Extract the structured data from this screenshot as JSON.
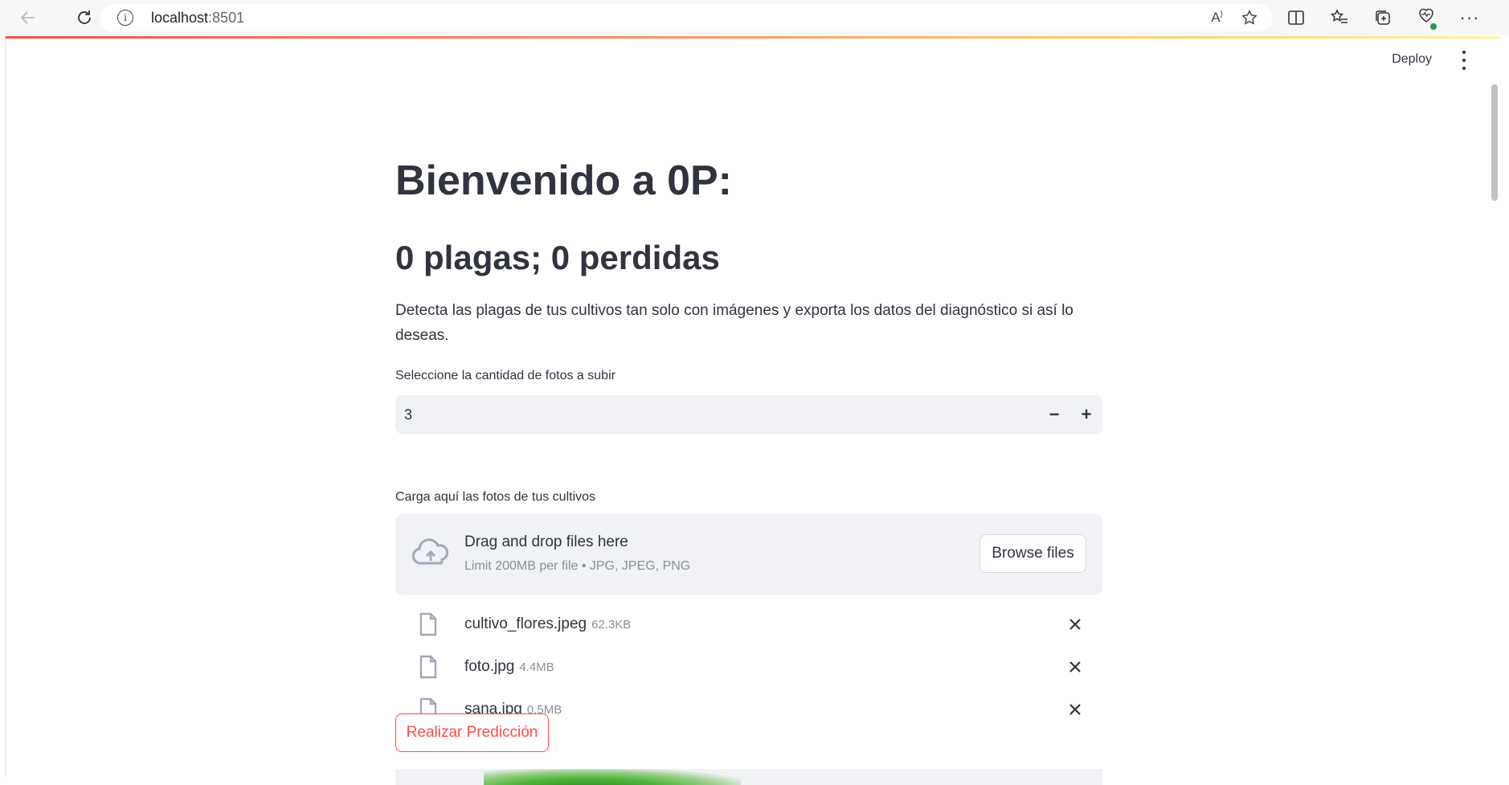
{
  "browser": {
    "url_host": "localhost",
    "url_port": ":8501",
    "back_icon": "arrow-left-icon",
    "reload_icon": "reload-icon"
  },
  "header": {
    "deploy_label": "Deploy",
    "menu_icon": "kebab-menu-icon"
  },
  "main": {
    "title": "Bienvenido a 0P:",
    "subtitle": "0 plagas; 0 perdidas",
    "description": "Detecta las plagas de tus cultivos tan solo con imágenes y exporta los datos del diagnóstico si así lo deseas.",
    "quantity": {
      "label": "Seleccione la cantidad de fotos a subir",
      "value": "3",
      "minus": "−",
      "plus": "+"
    },
    "uploader": {
      "label": "Carga aquí las fotos de tus cultivos",
      "drop_title": "Drag and drop files here",
      "limit_text": "Limit 200MB per file • JPG, JPEG, PNG",
      "browse_label": "Browse files"
    },
    "files": [
      {
        "name": "cultivo_flores.jpeg",
        "size": "62.3KB"
      },
      {
        "name": "foto.jpg",
        "size": "4.4MB"
      },
      {
        "name": "sana.jpg",
        "size": "0.5MB"
      }
    ],
    "predict_label": "Realizar Predicción"
  },
  "colors": {
    "primary": "#ff4b4b",
    "text": "#31333f",
    "muted": "#8c8f98",
    "input_bg": "#f0f2f6"
  }
}
